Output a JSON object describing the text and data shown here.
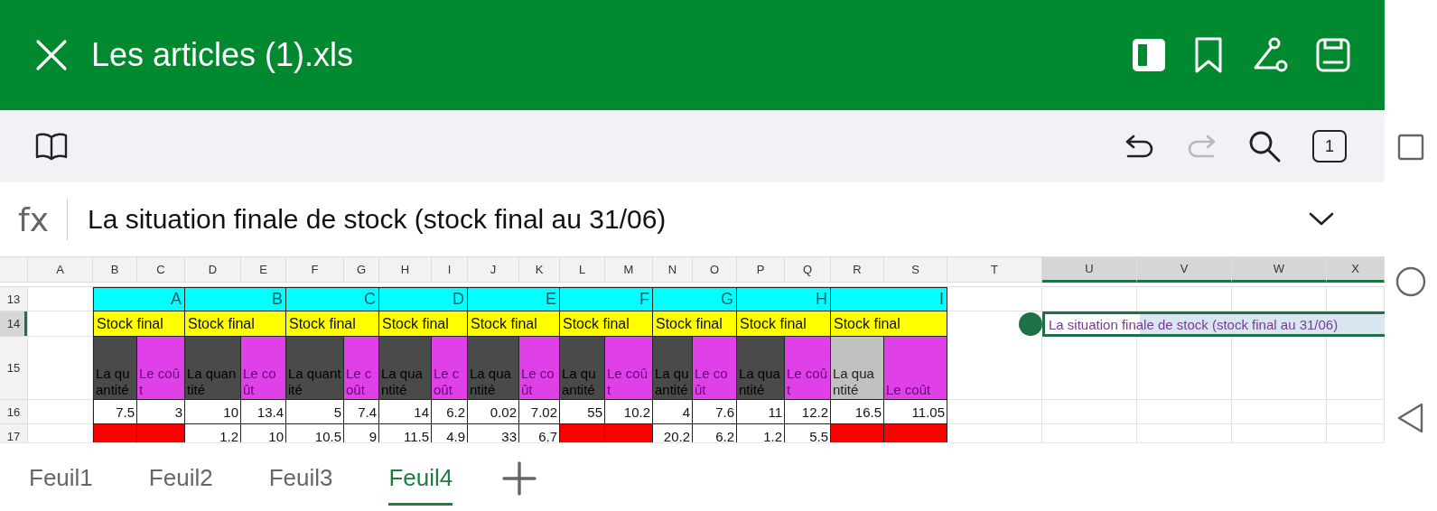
{
  "title_bar": {
    "title": "Les articles (1).xls"
  },
  "toolbar": {
    "page_count": "1",
    "redo_disabled": true
  },
  "formula_bar": {
    "label": "fx",
    "value": "La situation finale de stock (stock final au 31/06)"
  },
  "sheet": {
    "columns": [
      {
        "label": "A",
        "selected": false
      },
      {
        "label": "B",
        "selected": false
      },
      {
        "label": "C",
        "selected": false
      },
      {
        "label": "D",
        "selected": false
      },
      {
        "label": "E",
        "selected": false
      },
      {
        "label": "F",
        "selected": false
      },
      {
        "label": "G",
        "selected": false
      },
      {
        "label": "H",
        "selected": false
      },
      {
        "label": "I",
        "selected": false
      },
      {
        "label": "J",
        "selected": false
      },
      {
        "label": "K",
        "selected": false
      },
      {
        "label": "L",
        "selected": false
      },
      {
        "label": "M",
        "selected": false
      },
      {
        "label": "N",
        "selected": false
      },
      {
        "label": "O",
        "selected": false
      },
      {
        "label": "P",
        "selected": false
      },
      {
        "label": "Q",
        "selected": false
      },
      {
        "label": "R",
        "selected": false
      },
      {
        "label": "S",
        "selected": false
      },
      {
        "label": "T",
        "selected": false
      },
      {
        "label": "U",
        "selected": true
      },
      {
        "label": "V",
        "selected": true
      },
      {
        "label": "W",
        "selected": true
      },
      {
        "label": "X",
        "selected": true
      }
    ],
    "rows": [
      {
        "label": "13",
        "selected": false
      },
      {
        "label": "14",
        "selected": true
      },
      {
        "label": "15",
        "selected": false
      },
      {
        "label": "16",
        "selected": false
      },
      {
        "label": "17",
        "selected": false
      }
    ],
    "groups": [
      {
        "name": "A",
        "title": "Stock final",
        "fields": [
          {
            "label": "La quantité",
            "color": "#4a4a4a",
            "cells": [
              {
                "text": "7.5"
              },
              {
                "color": "#ff0000"
              }
            ]
          },
          {
            "label": "Le coût",
            "color": "#e040e8",
            "cells": [
              {
                "text": "3"
              },
              {
                "color": "#ff0000"
              }
            ]
          }
        ]
      },
      {
        "name": "B",
        "title": "Stock final",
        "fields": [
          {
            "label": "La quantité",
            "color": "#4a4a4a",
            "cells": [
              {
                "text": "10"
              },
              {
                "text": "1.2"
              }
            ]
          },
          {
            "label": "Le coût",
            "color": "#e040e8",
            "cells": [
              {
                "text": "13.4"
              },
              {
                "text": "10"
              }
            ]
          }
        ]
      },
      {
        "name": "C",
        "title": "Stock final",
        "fields": [
          {
            "label": "La quantité",
            "color": "#4a4a4a",
            "cells": [
              {
                "text": "5"
              },
              {
                "text": "10.5"
              }
            ]
          },
          {
            "label": "Le coût",
            "color": "#e040e8",
            "cells": [
              {
                "text": "7.4"
              },
              {
                "text": "9"
              }
            ]
          }
        ]
      },
      {
        "name": "D",
        "title": "Stock final",
        "fields": [
          {
            "label": "La quantité",
            "color": "#4a4a4a",
            "cells": [
              {
                "text": "14"
              },
              {
                "text": "11.5"
              }
            ]
          },
          {
            "label": "Le coût",
            "color": "#e040e8",
            "cells": [
              {
                "text": "6.2"
              },
              {
                "text": "4.9"
              }
            ]
          }
        ]
      },
      {
        "name": "E",
        "title": "Stock final",
        "fields": [
          {
            "label": "La quantité",
            "color": "#4a4a4a",
            "cells": [
              {
                "text": "0.02"
              },
              {
                "text": "33"
              }
            ]
          },
          {
            "label": "Le coût",
            "color": "#e040e8",
            "cells": [
              {
                "text": "7.02"
              },
              {
                "text": "6.7"
              }
            ]
          }
        ]
      },
      {
        "name": "F",
        "title": "Stock final",
        "fields": [
          {
            "label": "La quantité",
            "color": "#4a4a4a",
            "cells": [
              {
                "text": "55"
              },
              {
                "color": "#ff0000"
              }
            ]
          },
          {
            "label": "Le coût",
            "color": "#e040e8",
            "cells": [
              {
                "text": "10.2"
              },
              {
                "color": "#ff0000"
              }
            ]
          }
        ]
      },
      {
        "name": "G",
        "title": "Stock final",
        "fields": [
          {
            "label": "La quantité",
            "color": "#4a4a4a",
            "cells": [
              {
                "text": "4"
              },
              {
                "text": "20.2"
              }
            ]
          },
          {
            "label": "Le coût",
            "color": "#e040e8",
            "cells": [
              {
                "text": "7.6"
              },
              {
                "text": "6.2"
              }
            ]
          }
        ]
      },
      {
        "name": "H",
        "title": "Stock final",
        "fields": [
          {
            "label": "La quantité",
            "color": "#4a4a4a",
            "cells": [
              {
                "text": "11"
              },
              {
                "text": "1.2"
              }
            ]
          },
          {
            "label": "Le coût",
            "color": "#e040e8",
            "cells": [
              {
                "text": "12.2"
              },
              {
                "text": "5.5"
              }
            ]
          }
        ]
      },
      {
        "name": "I",
        "title": "Stock final",
        "fields": [
          {
            "label": "La quantité",
            "color": "#c0c0c0",
            "cells": [
              {
                "text": "16.5"
              },
              {
                "color": "#ff0000"
              }
            ]
          },
          {
            "label": "Le coût",
            "color": "#e040e8",
            "cells": [
              {
                "text": "11.05"
              },
              {
                "color": "#ff0000"
              }
            ]
          }
        ]
      }
    ],
    "active_cell": {
      "text": "La situation finale de stock (stock final au 31/06)"
    }
  },
  "sheet_tabs": [
    {
      "label": "Feuil1",
      "selected": false
    },
    {
      "label": "Feuil2",
      "selected": false
    },
    {
      "label": "Feuil3",
      "selected": false
    },
    {
      "label": "Feuil4",
      "selected": true
    }
  ]
}
